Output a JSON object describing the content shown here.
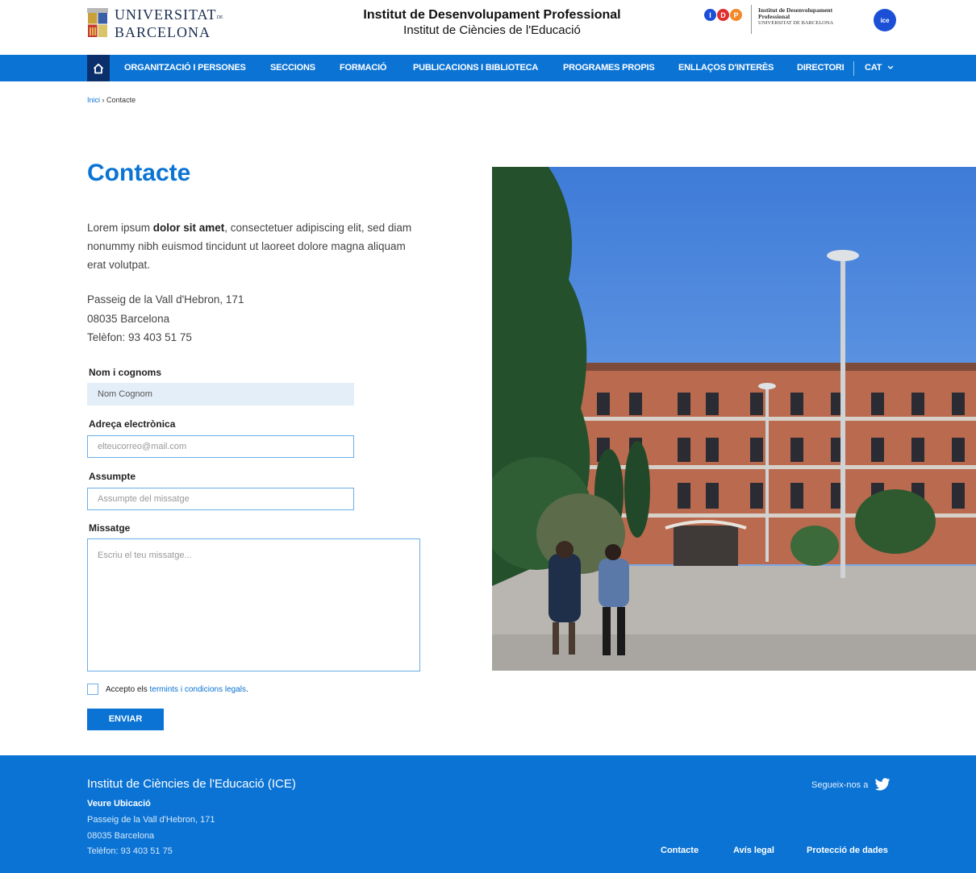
{
  "header": {
    "university_name_line1": "UNIVERSITAT",
    "university_name_de": "DE",
    "university_name_line2": "BARCELONA",
    "title": "Institut de Desenvolupament Professional",
    "subtitle": "Institut de Ciències de l'Educació",
    "idp_letters": [
      "I",
      "D",
      "P"
    ],
    "idp_text_line1": "Institut de Desenvolupament",
    "idp_text_line2": "Professional",
    "idp_text_line3": "UNIVERSITAT DE BARCELONA",
    "ice_logo_text": "ice"
  },
  "nav": {
    "items": [
      "ORGANITZACIÓ I PERSONES",
      "SECCIONS",
      "FORMACIÓ",
      "PUBLICACIONS I BIBLIOTECA",
      "PROGRAMES PROPIS",
      "ENLLAÇOS D'INTERÈS",
      "DIRECTORI"
    ],
    "language": "CAT"
  },
  "breadcrumb": {
    "home": "Inici",
    "separator": "›",
    "current": "Contacte"
  },
  "main": {
    "title": "Contacte",
    "intro_pre": "Lorem ipsum ",
    "intro_bold": "dolor sit amet",
    "intro_post": ", consectetuer adipiscing elit, sed diam nonummy nibh euismod tincidunt ut laoreet dolore magna aliquam erat volutpat.",
    "address_line1": "Passeig de la Vall d'Hebron, 171",
    "address_line2": "08035 Barcelona",
    "address_line3": "Telèfon: 93 403 51 75"
  },
  "form": {
    "name_label": "Nom i cognoms",
    "name_value": "Nom Cognom",
    "email_label": "Adreça electrònica",
    "email_placeholder": "elteucorreo@mail.com",
    "subject_label": "Assumpte",
    "subject_placeholder": "Assumpte del missatge",
    "message_label": "Missatge",
    "message_placeholder": "Escriu el teu missatge...",
    "accept_prefix": "Accepto els ",
    "accept_link": "termints i condicions legals",
    "accept_suffix": ".",
    "submit_label": "ENVIAR"
  },
  "footer": {
    "org_name": "Institut de Ciències de l'Educació (ICE)",
    "location_link": "Veure Ubicació",
    "address_line1": "Passeig de la Vall d'Hebron, 171",
    "address_line2": "08035 Barcelona",
    "address_line3": "Telèfon: 93 403 51 75",
    "follow_text": "Segueix-nos a",
    "links": [
      "Contacte",
      "Avís legal",
      "Protecció de dades"
    ]
  },
  "colors": {
    "primary": "#0a73d4",
    "home_button": "#0b2f6b",
    "title_blue": "#0a73d4"
  },
  "icons": [
    "home-icon",
    "chevron-down-icon",
    "twitter-icon",
    "ub-shield-icon"
  ]
}
